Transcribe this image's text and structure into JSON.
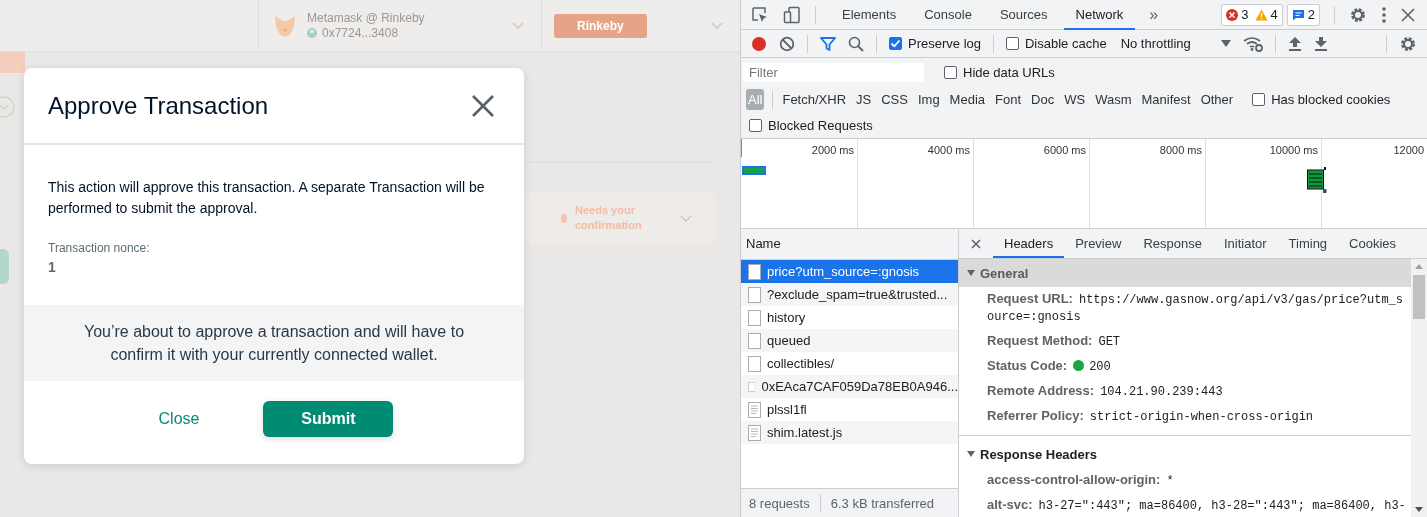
{
  "app": {
    "wallet": {
      "name": "Metamask @ Rinkeby",
      "address": "0x7724...3408"
    },
    "network": "Rinkeby",
    "status": "Needs your confirmation"
  },
  "dialog": {
    "title": "Approve Transaction",
    "description": "This action will approve this transaction. A separate Transaction will be performed to submit the approval.",
    "nonce_label": "Transaction nonce:",
    "nonce": "1",
    "notice": "You’re about to approve a transaction and will have to confirm it with your currently connected wallet.",
    "buttons": [
      {
        "label": "Close",
        "kind": "text"
      },
      {
        "label": "Submit",
        "kind": "primary"
      }
    ]
  },
  "devtools": {
    "tabs": [
      {
        "label": "Elements",
        "selected": false
      },
      {
        "label": "Console",
        "selected": false
      },
      {
        "label": "Sources",
        "selected": false
      },
      {
        "label": "Network",
        "selected": true
      }
    ],
    "more_tabs": "»",
    "errors": "3",
    "warnings": "4",
    "messages": "2",
    "recording": true,
    "preserve_log": {
      "label": "Preserve log",
      "checked": true
    },
    "disable_cache": {
      "label": "Disable cache",
      "checked": false
    },
    "throttling": "No throttling",
    "filter": {
      "placeholder": "Filter"
    },
    "hide_data_urls": {
      "label": "Hide data URLs",
      "checked": false
    },
    "types": [
      {
        "label": "All",
        "selected": true
      },
      {
        "label": "Fetch/XHR",
        "selected": false
      },
      {
        "label": "JS",
        "selected": false
      },
      {
        "label": "CSS",
        "selected": false
      },
      {
        "label": "Img",
        "selected": false
      },
      {
        "label": "Media",
        "selected": false
      },
      {
        "label": "Font",
        "selected": false
      },
      {
        "label": "Doc",
        "selected": false
      },
      {
        "label": "WS",
        "selected": false
      },
      {
        "label": "Wasm",
        "selected": false
      },
      {
        "label": "Manifest",
        "selected": false
      },
      {
        "label": "Other",
        "selected": false
      }
    ],
    "has_blocked_cookies": {
      "label": "Has blocked cookies",
      "checked": false
    },
    "blocked_requests": {
      "label": "Blocked Requests",
      "checked": false
    },
    "timeline_ticks": [
      "2000 ms",
      "4000 ms",
      "6000 ms",
      "8000 ms",
      "10000 ms",
      "12000"
    ],
    "requests": {
      "column": "Name",
      "rows": [
        {
          "name": "price?utm_source=:gnosis",
          "kind": "fetch",
          "selected": true
        },
        {
          "name": "?exclude_spam=true&trusted...",
          "kind": "fetch",
          "selected": false
        },
        {
          "name": "history",
          "kind": "fetch",
          "selected": false
        },
        {
          "name": "queued",
          "kind": "fetch",
          "selected": false
        },
        {
          "name": "collectibles/",
          "kind": "fetch",
          "selected": false
        },
        {
          "name": "0xEAca7CAF059Da78EB0A946...",
          "kind": "fetch",
          "selected": false
        },
        {
          "name": "plssl1fl",
          "kind": "script",
          "selected": false
        },
        {
          "name": "shim.latest.js",
          "kind": "script",
          "selected": false
        }
      ]
    },
    "summary": [
      "8 requests",
      "6.3 kB transferred"
    ],
    "detail_tabs": [
      {
        "label": "Headers",
        "selected": true
      },
      {
        "label": "Preview",
        "selected": false
      },
      {
        "label": "Response",
        "selected": false
      },
      {
        "label": "Initiator",
        "selected": false
      },
      {
        "label": "Timing",
        "selected": false
      },
      {
        "label": "Cookies",
        "selected": false
      }
    ],
    "sections": [
      {
        "title": "General",
        "expanded": true,
        "highlighted": true,
        "rows": [
          {
            "key": "Request URL:",
            "value": "https://www.gasnow.org/api/v3/gas/price?utm_source=:gnosis"
          },
          {
            "key": "Request Method:",
            "value": "GET"
          },
          {
            "key": "Status Code:",
            "value": "200",
            "color": "#1ea446"
          },
          {
            "key": "Remote Address:",
            "value": "104.21.90.239:443"
          },
          {
            "key": "Referrer Policy:",
            "value": "strict-origin-when-cross-origin"
          }
        ]
      },
      {
        "title": "Response Headers",
        "expanded": true,
        "highlighted": false,
        "rows": [
          {
            "key": "access-control-allow-origin:",
            "value": "*"
          },
          {
            "key": "alt-svc:",
            "value": "h3-27=\":443\"; ma=86400, h3-28=\":443\"; ma=86400, h3-"
          }
        ]
      }
    ]
  }
}
